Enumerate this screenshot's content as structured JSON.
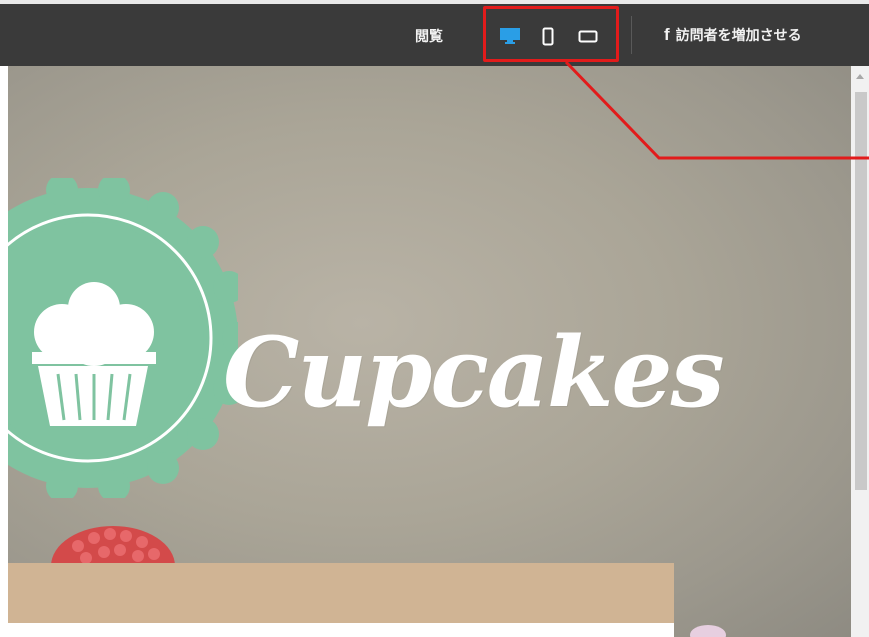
{
  "toolbar": {
    "preview_label": "閲覧",
    "devices": [
      {
        "name": "desktop",
        "active": true
      },
      {
        "name": "mobile",
        "active": false
      },
      {
        "name": "tablet",
        "active": false
      }
    ],
    "facebook_icon": "f",
    "facebook_label": "訪問者を増加させる",
    "active_color": "#2a9ee6",
    "highlight_color": "#e21b1b"
  },
  "site": {
    "title": "Cupcakes",
    "logo_color": "#7fc3a0",
    "panel_color": "#d0b494"
  }
}
